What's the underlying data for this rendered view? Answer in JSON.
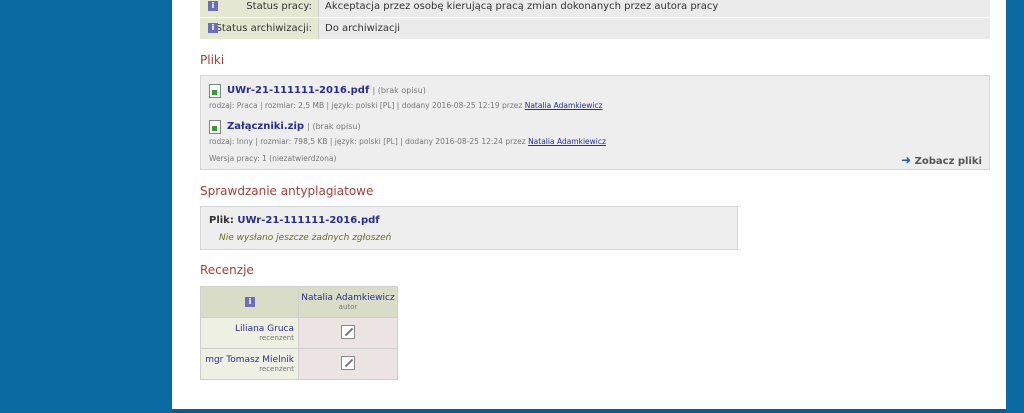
{
  "status": {
    "rows": [
      {
        "label": "Status pracy:",
        "value": "Akceptacja przez osobę kierującą pracą zmian dokonanych przez autora pracy"
      },
      {
        "label": "Status archiwizacji:",
        "value": "Do archiwizacji"
      }
    ]
  },
  "files": {
    "heading": "Pliki",
    "items": [
      {
        "name": "UWr-21-111111-2016.pdf",
        "desc": "| (brak opisu)",
        "meta": "rodzaj: Praca | rozmiar: 2,5 MB | język: polski [PL] | dodany 2016-08-25 12:19 przez",
        "author": "Natalia Adamkiewicz"
      },
      {
        "name": "Załączniki.zip",
        "desc": "| (brak opisu)",
        "meta": "rodzaj: Inny | rozmiar: 798,5 KB | język: polski [PL] | dodany 2016-08-25 12:24 przez",
        "author": "Natalia Adamkiewicz"
      }
    ],
    "version": "Wersja pracy: 1 (niezatwierdzona)",
    "see_files": "Zobacz pliki"
  },
  "antiplagiat": {
    "heading": "Sprawdzanie antyplagiatowe",
    "file_label": "Plik:",
    "file_name": "UWr-21-111111-2016.pdf",
    "message": "Nie wysłano jeszcze żadnych zgłoszeń"
  },
  "reviews": {
    "heading": "Recenzje",
    "author_name": "Natalia Adamkiewicz",
    "author_role": "autor",
    "reviewers": [
      {
        "name": "Liliana Gruca",
        "role": "recenzent"
      },
      {
        "name": "mgr Tomasz Mielnik",
        "role": "recenzent"
      }
    ]
  }
}
